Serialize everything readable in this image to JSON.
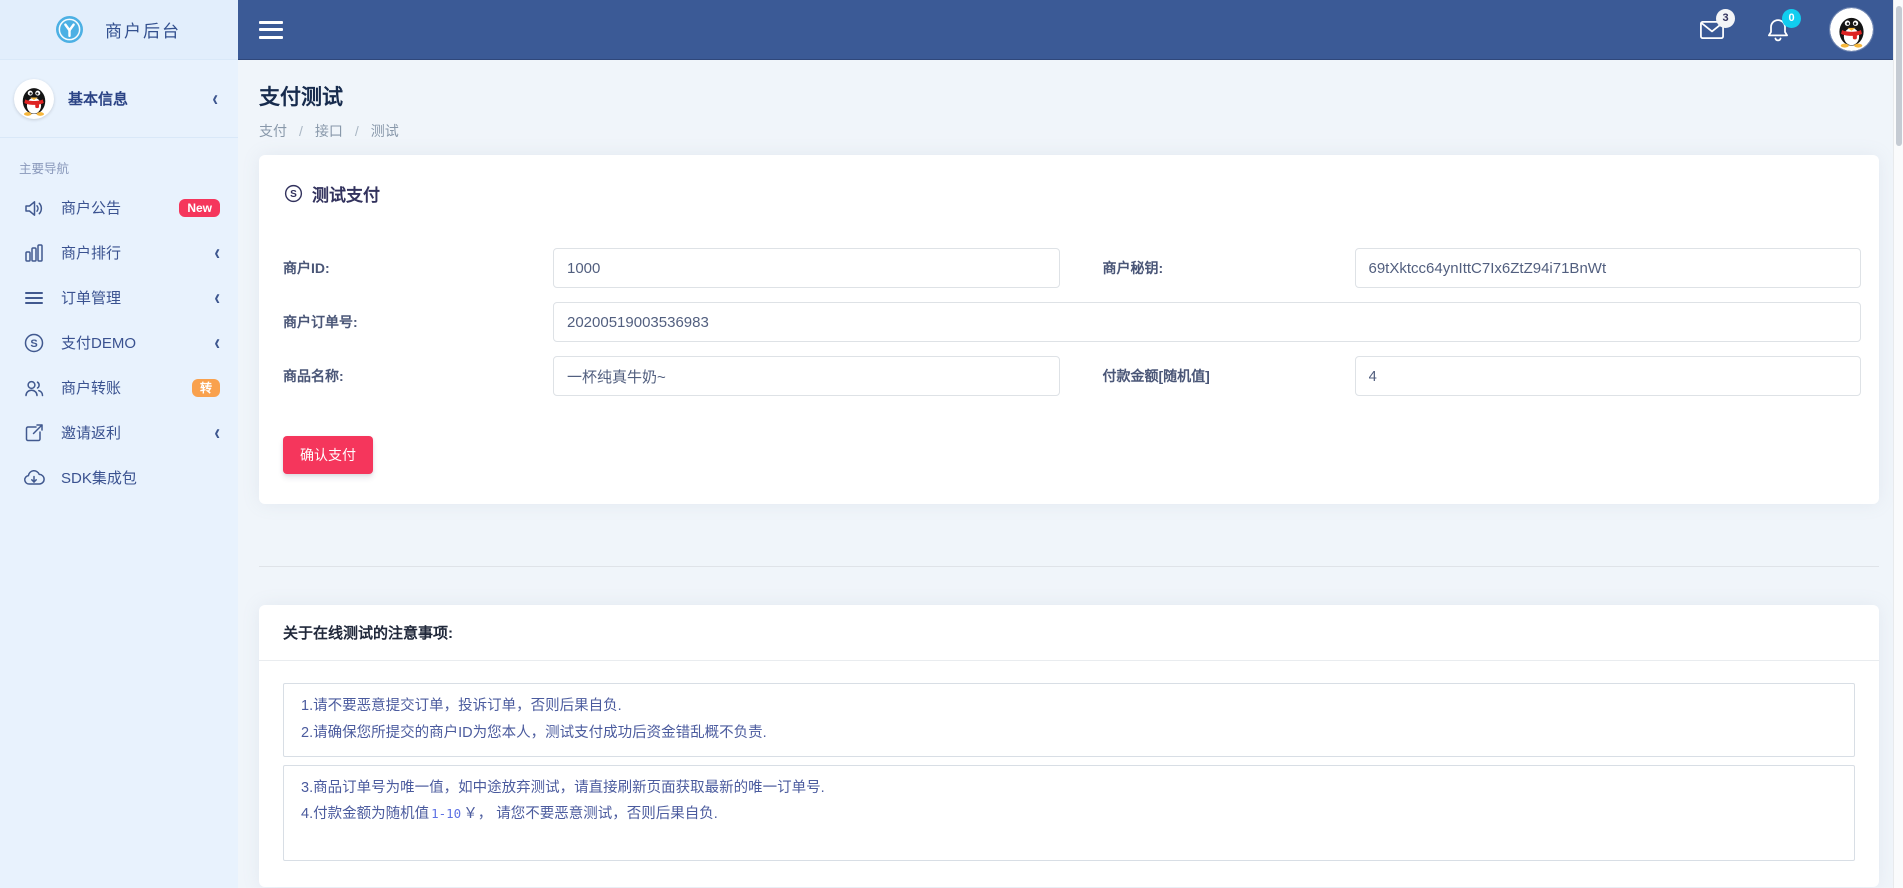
{
  "brand": {
    "title": "商户后台"
  },
  "sidebar": {
    "user": {
      "name": "基本信息"
    },
    "section_label": "主要导航",
    "items": [
      {
        "label": "商户公告",
        "icon": "announcement-icon",
        "badge": "New"
      },
      {
        "label": "商户排行",
        "icon": "bar-chart-icon",
        "chevron": "‹"
      },
      {
        "label": "订单管理",
        "icon": "list-icon",
        "chevron": "‹"
      },
      {
        "label": "支付DEMO",
        "icon": "skype-icon",
        "chevron": "‹"
      },
      {
        "label": "商户转账",
        "icon": "users-icon",
        "badge": "转"
      },
      {
        "label": "邀请返利",
        "icon": "share-icon",
        "chevron": "‹"
      },
      {
        "label": "SDK集成包",
        "icon": "cloud-download-icon"
      }
    ],
    "chevron": "‹"
  },
  "header": {
    "mail_badge": "3",
    "bell_badge": "0"
  },
  "page": {
    "title": "支付测试",
    "breadcrumb": [
      "支付",
      "接口",
      "测试"
    ],
    "breadcrumb_sep": "/"
  },
  "form_card": {
    "title": "测试支付",
    "fields": {
      "merchant_id": {
        "label": "商户ID:",
        "value": "1000"
      },
      "merchant_key": {
        "label": "商户秘钥:",
        "value": "69tXktcc64ynIttC7Ix6ZtZ94i71BnWt"
      },
      "order_no": {
        "label": "商户订单号:",
        "value": "20200519003536983"
      },
      "product_name": {
        "label": "商品名称:",
        "value": "一杯纯真牛奶~"
      },
      "amount": {
        "label": "付款金额[随机值]",
        "value": "4"
      }
    },
    "submit_label": "确认支付"
  },
  "notes_card": {
    "title": "关于在线测试的注意事项:",
    "box1_line1": "1.请不要恶意提交订单，投诉订单，否则后果自负.",
    "box1_line2": "2.请确保您所提交的商户ID为您本人，测试支付成功后资金错乱概不负责.",
    "box2_line3": "3.商品订单号为唯一值，如中途放弃测试，请直接刷新页面获取最新的唯一订单号.",
    "box2_line4_prefix": "4.付款金额为随机值",
    "box2_line4_code": "1-10",
    "box2_line4_suffix": "￥， 请您不要恶意测试，否则后果自负."
  },
  "colors": {
    "header_bg": "#3b5a96",
    "sidebar_bg": "#e8f2fd",
    "badge_new_bg": "#f5365c",
    "badge_transfer_bg": "#f9a14d",
    "bell_badge_bg": "#11cdef",
    "submit_button_bg": "#f5365c",
    "code_blue": "#5e72e4",
    "logo_blue": "#4cb0e4"
  }
}
